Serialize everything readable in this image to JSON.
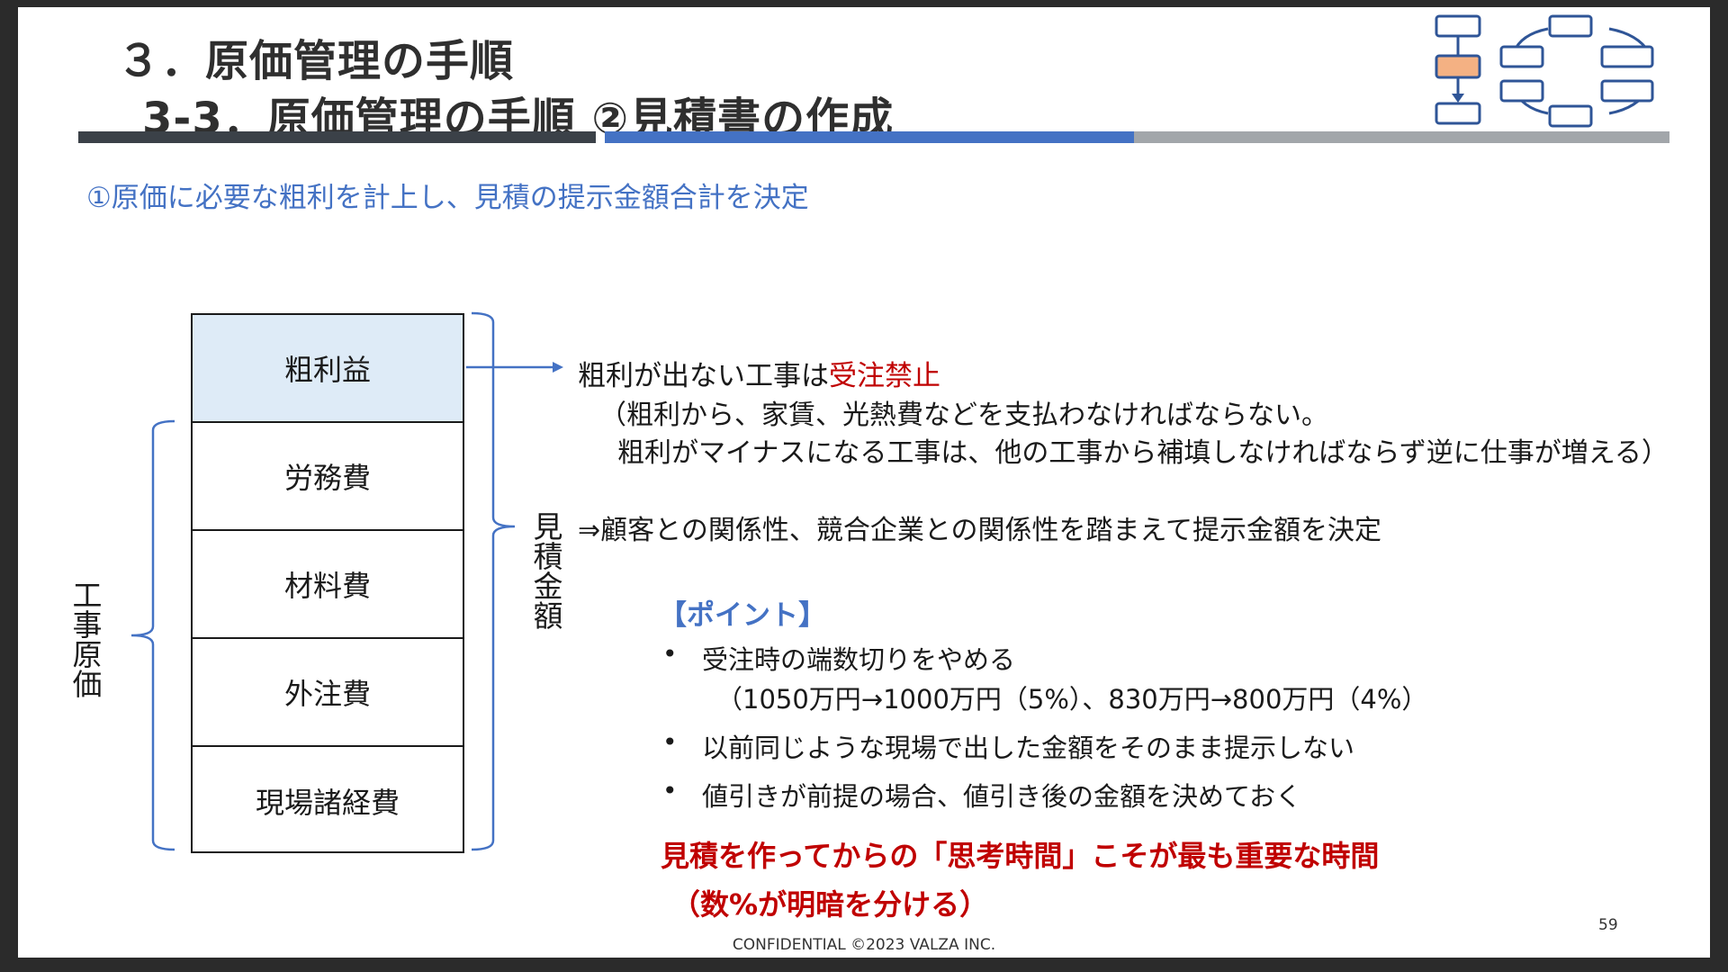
{
  "header": {
    "title_main": "３．原価管理の手順",
    "title_sub": "3-3．原価管理の手順 ②見積書の作成"
  },
  "subtitle": "①原価に必要な粗利を計上し、見積の提示金額合計を決定",
  "cost_stack": {
    "items": [
      "粗利益",
      "労務費",
      "材料費",
      "外注費",
      "現場諸経費"
    ],
    "highlight_color": "#deebf7"
  },
  "labels": {
    "construction_cost": "工事原価",
    "estimate_amount": "見積金額"
  },
  "explanation": {
    "line1_prefix": "粗利が出ない工事は",
    "line1_emphasis": "受注禁止",
    "line2": "（粗利から、家賃、光熱費などを支払わなければならない。",
    "line3": "粗利がマイナスになる工事は、他の工事から補填しなければならず逆に仕事が増える）",
    "line4": "⇒顧客との関係性、競合企業との関係性を踏まえて提示金額を決定"
  },
  "points": {
    "heading": "【ポイント】",
    "items": [
      "受注時の端数切りをやめる",
      "（1050万円→1000万円（5%）、830万円→800万円（4%）",
      "以前同じような現場で出した金額をそのまま提示しない",
      "値引きが前提の場合、値引き後の金額を決めておく"
    ],
    "bullet_symbol": "•"
  },
  "conclusion": {
    "line1": "見積を作ってからの「思考時間」こそが最も重要な時間",
    "line2": "（数%が明暗を分ける）"
  },
  "footer": {
    "confidential": "CONFIDENTIAL ©2023 VALZA INC.",
    "page_number": "59"
  },
  "colors": {
    "accent_blue": "#4472c4",
    "emphasis_red": "#c00000",
    "bar_dark": "#3b4148",
    "bar_gray": "#a2a6aa",
    "icon_orange": "#f4b183",
    "icon_navy": "#2f5597"
  },
  "icons": [
    "flowchart-icon",
    "cycle-diagram-icon"
  ]
}
